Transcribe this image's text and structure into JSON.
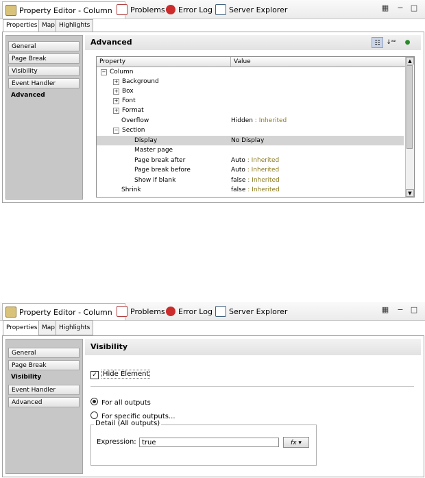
{
  "view_tabs": [
    {
      "label": "Property Editor - Column",
      "icon": "property-editor-icon"
    },
    {
      "label": "Problems",
      "icon": "problems-icon"
    },
    {
      "label": "Error Log",
      "icon": "error-log-icon"
    },
    {
      "label": "Server Explorer",
      "icon": "server-explorer-icon"
    }
  ],
  "sub_tabs": [
    "Properties",
    "Map",
    "Highlights"
  ],
  "sidebar_items": [
    "General",
    "Page Break",
    "Visibility",
    "Event Handler",
    "Advanced"
  ],
  "advanced": {
    "title": "Advanced",
    "col_property": "Property",
    "col_value": "Value",
    "rows": [
      {
        "name": "Column",
        "value": "",
        "inherited": ""
      },
      {
        "name": "Background",
        "value": "",
        "inherited": ""
      },
      {
        "name": "Box",
        "value": "",
        "inherited": ""
      },
      {
        "name": "Font",
        "value": "",
        "inherited": ""
      },
      {
        "name": "Format",
        "value": "",
        "inherited": ""
      },
      {
        "name": "Overflow",
        "value": "Hidden",
        "inherited": " : Inherited"
      },
      {
        "name": "Section",
        "value": "",
        "inherited": ""
      },
      {
        "name": "Display",
        "value": "No Display",
        "inherited": ""
      },
      {
        "name": "Master page",
        "value": "",
        "inherited": ""
      },
      {
        "name": "Page break after",
        "value": "Auto",
        "inherited": " : Inherited"
      },
      {
        "name": "Page break before",
        "value": "Auto",
        "inherited": " : Inherited"
      },
      {
        "name": "Show if blank",
        "value": "false",
        "inherited": " : Inherited"
      },
      {
        "name": "Shrink",
        "value": "false",
        "inherited": " : Inherited"
      }
    ]
  },
  "visibility": {
    "title": "Visibility",
    "hide_element_label": "Hide Element",
    "hide_element_checked": true,
    "for_all_outputs": "For all outputs",
    "for_specific_outputs": "For specific outputs...",
    "group_label": "Detail (All outputs)",
    "expression_label": "Expression:",
    "expression_value": "true",
    "fx_label": "fx"
  },
  "colors": {
    "inherited": "#8b7a1e",
    "selected_row": "#d4d4d4",
    "sidebar_bg": "#c7c7c7"
  }
}
